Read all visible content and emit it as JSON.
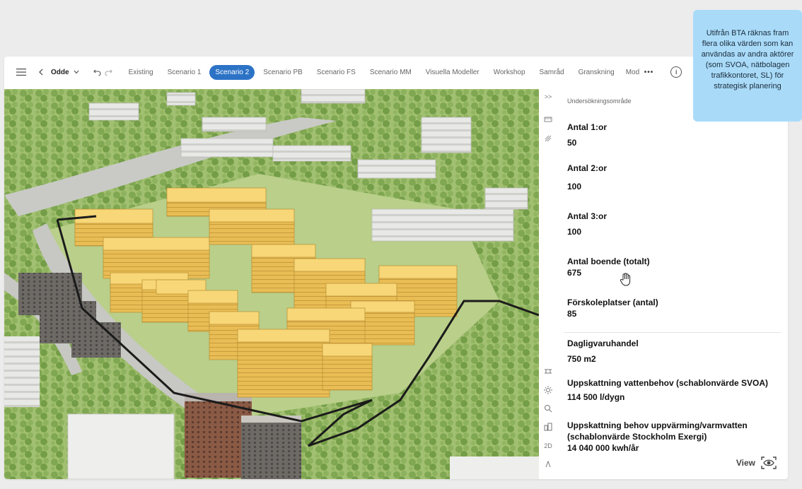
{
  "toolbar": {
    "project": "Odde",
    "tabs": [
      {
        "label": "Existing",
        "active": false
      },
      {
        "label": "Scenario 1",
        "active": false
      },
      {
        "label": "Scenario 2",
        "active": true
      },
      {
        "label": "Scenario PB",
        "active": false
      },
      {
        "label": "Scenario FS",
        "active": false
      },
      {
        "label": "Scenario MM",
        "active": false
      },
      {
        "label": "Visuella Modeller",
        "active": false
      },
      {
        "label": "Workshop",
        "active": false
      },
      {
        "label": "Samråd",
        "active": false
      },
      {
        "label": "Granskning",
        "active": false
      },
      {
        "label": "Mod",
        "active": false
      }
    ],
    "more": "•••"
  },
  "panel": {
    "title": "Undersökningsområde",
    "metrics": [
      {
        "label": "Antal 1:or",
        "value": "50"
      },
      {
        "label": "Antal 2:or",
        "value": "100"
      },
      {
        "label": "Antal 3:or",
        "value": "100"
      },
      {
        "label": "Antal boende (totalt)",
        "value": "675"
      },
      {
        "label": "Förskoleplatser (antal)",
        "value": "85"
      },
      {
        "label": "Dagligvaruhandel",
        "value": "750 m2"
      },
      {
        "label": "Uppskattning vattenbehov (schablonvärde SVOA)",
        "value": "114 500 l/dygn"
      },
      {
        "label": "Uppskattning behov uppvärming/varmvatten (schablonvärde Stockholm Exergi)",
        "value": "14 040 000 kwh/år"
      }
    ],
    "view_label": "View"
  },
  "rail": {
    "toggle": ">>",
    "mode_2d": "2D"
  },
  "tooltip": {
    "text": "Utifrån BTA räknas fram flera olika värden som kan användas av andra aktörer (som SVOA, nätbolagen trafikkontoret, SL) för strategisk planering"
  },
  "colors": {
    "accent": "#2c73c6",
    "tooltip_bg": "#a9dbf9",
    "building_new": "#f1c75b",
    "vegetation": "#7faa4e"
  }
}
